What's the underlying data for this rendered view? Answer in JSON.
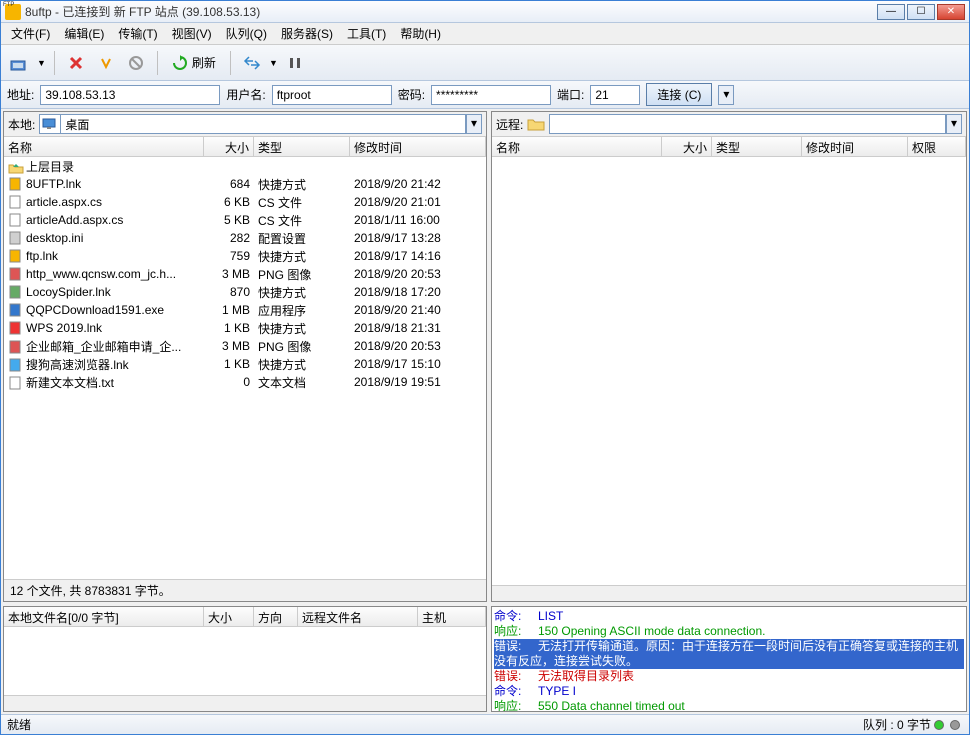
{
  "title": "8uftp - 已连接到 新 FTP 站点 (39.108.53.13)",
  "menu": [
    "文件(F)",
    "编辑(E)",
    "传输(T)",
    "视图(V)",
    "队列(Q)",
    "服务器(S)",
    "工具(T)",
    "帮助(H)"
  ],
  "toolbar": {
    "refresh": "刷新"
  },
  "conn": {
    "addr_label": "地址:",
    "addr": "39.108.53.13",
    "user_label": "用户名:",
    "user": "ftproot",
    "pass_label": "密码:",
    "pass": "*********",
    "port_label": "端口:",
    "port": "21",
    "connect_btn": "连接 (C)"
  },
  "local": {
    "label": "本地:",
    "path": "桌面",
    "cols": {
      "name": "名称",
      "size": "大小",
      "type": "类型",
      "mtime": "修改时间"
    },
    "parent": "上层目录",
    "files": [
      {
        "icon": "ftp",
        "name": "8UFTP.lnk",
        "size": "684",
        "type": "快捷方式",
        "mtime": "2018/9/20 21:42"
      },
      {
        "icon": "file",
        "name": "article.aspx.cs",
        "size": "6 KB",
        "type": "CS 文件",
        "mtime": "2018/9/20 21:01"
      },
      {
        "icon": "file",
        "name": "articleAdd.aspx.cs",
        "size": "5 KB",
        "type": "CS 文件",
        "mtime": "2018/1/11 16:00"
      },
      {
        "icon": "ini",
        "name": "desktop.ini",
        "size": "282",
        "type": "配置设置",
        "mtime": "2018/9/17 13:28"
      },
      {
        "icon": "ftp",
        "name": "ftp.lnk",
        "size": "759",
        "type": "快捷方式",
        "mtime": "2018/9/17 14:16"
      },
      {
        "icon": "png",
        "name": "http_www.qcnsw.com_jc.h...",
        "size": "3 MB",
        "type": "PNG 图像",
        "mtime": "2018/9/20 20:53"
      },
      {
        "icon": "app",
        "name": "LocoySpider.lnk",
        "size": "870",
        "type": "快捷方式",
        "mtime": "2018/9/18 17:20"
      },
      {
        "icon": "shield",
        "name": "QQPCDownload1591.exe",
        "size": "1 MB",
        "type": "应用程序",
        "mtime": "2018/9/20 21:40"
      },
      {
        "icon": "wps",
        "name": "WPS 2019.lnk",
        "size": "1 KB",
        "type": "快捷方式",
        "mtime": "2018/9/18 21:31"
      },
      {
        "icon": "png",
        "name": "企业邮箱_企业邮箱申请_企...",
        "size": "3 MB",
        "type": "PNG 图像",
        "mtime": "2018/9/20 20:53"
      },
      {
        "icon": "browser",
        "name": "搜狗高速浏览器.lnk",
        "size": "1 KB",
        "type": "快捷方式",
        "mtime": "2018/9/17 15:10"
      },
      {
        "icon": "txt",
        "name": "新建文本文档.txt",
        "size": "0",
        "type": "文本文档",
        "mtime": "2018/9/19 19:51"
      }
    ],
    "status": "12 个文件, 共 8783831 字节。"
  },
  "remote": {
    "label": "远程:",
    "path": "",
    "cols": {
      "name": "名称",
      "size": "大小",
      "type": "类型",
      "mtime": "修改时间",
      "perm": "权限"
    }
  },
  "queue": {
    "cols": {
      "name": "本地文件名[0/0 字节]",
      "size": "大小",
      "dir": "方向",
      "remote": "远程文件名",
      "host": "主机"
    }
  },
  "log": [
    {
      "cls": "cmd",
      "label": "命令:",
      "text": "LIST"
    },
    {
      "cls": "resp",
      "label": "响应:",
      "text": "150 Opening ASCII mode data connection."
    },
    {
      "cls": "err sel",
      "label": "错误:",
      "text": "无法打开传输通道。原因：由于连接方在一段时间后没有正确答复或连接的主机没有反应，连接尝试失败。"
    },
    {
      "cls": "err",
      "label": "错误:",
      "text": "无法取得目录列表"
    },
    {
      "cls": "cmd",
      "label": "命令:",
      "text": "TYPE I"
    },
    {
      "cls": "resp",
      "label": "响应:",
      "text": "550 Data channel timed out"
    }
  ],
  "statusbar": {
    "ready": "就绪",
    "queue": "队列 : 0 字节"
  }
}
